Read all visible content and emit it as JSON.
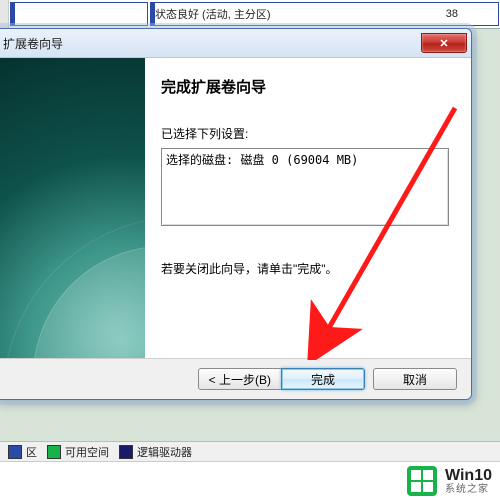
{
  "background": {
    "partitionStatus": "状态良好 (活动, 主分区)",
    "partitionSizeNumber": "38",
    "legend": {
      "primary": {
        "label": "区",
        "color": "#2a4aa8"
      },
      "free": {
        "label": "可用空间",
        "color": "#17b24a"
      },
      "logical": {
        "label": "逻辑驱动器",
        "color": "#1a1a6a"
      }
    }
  },
  "dialog": {
    "windowTitle": "扩展卷向导",
    "heading": "完成扩展卷向导",
    "selectedLabel": "已选择下列设置:",
    "summaryText": "选择的磁盘: 磁盘 0 (69004 MB)",
    "closeHint": "若要关闭此向导，请单击\"完成\"。",
    "buttons": {
      "back": "< 上一步(B)",
      "finish": "完成",
      "cancel": "取消"
    },
    "closeX": "✕"
  },
  "brand": {
    "title": "Win10",
    "subtitle": "系统之家"
  }
}
